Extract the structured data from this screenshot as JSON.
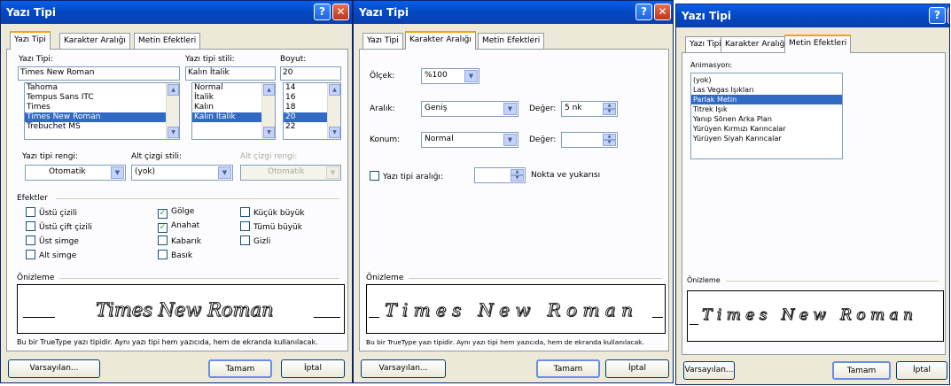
{
  "title": "Yazı Tipi",
  "help": "?",
  "close": "✕",
  "tabs": [
    "Yazı Tipi",
    "Karakter Aralığı",
    "Metin Efektleri"
  ],
  "font_tab": {
    "font_label": "Yazı Tipi:",
    "font_value": "Times New Roman",
    "fonts": [
      "Tahoma",
      "Tempus Sans ITC",
      "Times",
      "Times New Roman",
      "Trebuchet MS"
    ],
    "style_label": "Yazı tipi stili:",
    "style_value": "Kalın İtalik",
    "styles": [
      "Normal",
      "İtalik",
      "Kalın",
      "Kalın İtalik"
    ],
    "size_label": "Boyut:",
    "size_value": "20",
    "sizes": [
      "14",
      "16",
      "18",
      "20",
      "22"
    ],
    "color_label": "Yazı tipi rengi:",
    "color_value": "Otomatik",
    "underline_label": "Alt çizgi stili:",
    "underline_value": "(yok)",
    "underline_color_label": "Alt çizgi rengi:",
    "underline_color_value": "Otomatik",
    "effects_label": "Efektler",
    "effects": {
      "strike": "Üstü çizili",
      "dstrike": "Üstü çift çizili",
      "sup": "Üst simge",
      "sub": "Alt simge",
      "shadow": "Gölge",
      "outline": "Anahat",
      "emboss": "Kabarık",
      "engrave": "Basık",
      "smallcaps": "Küçük büyük",
      "allcaps": "Tümü büyük",
      "hidden": "Gizli"
    },
    "checked_mark": "✓"
  },
  "spacing_tab": {
    "scale_label": "Ölçek:",
    "scale_value": "%100",
    "spacing_label": "Aralık:",
    "spacing_value": "Geniş",
    "value_label": "Değer:",
    "spacing_amount": "5 nk",
    "position_label": "Konum:",
    "position_value": "Normal",
    "value2_label": "Değer:",
    "kerning_label": "Yazı tipi aralığı:",
    "kerning_suffix": "Nokta ve yukarısı"
  },
  "effects_tab": {
    "anim_label": "Animasyon:",
    "animations": [
      "(yok)",
      "Las Vegas Işıkları",
      "Parlak Metin",
      "Titrek Işık",
      "Yanıp Sönen Arka Plan",
      "Yürüyen Kırmızı Karıncalar",
      "Yürüyen Siyah Karıncalar"
    ]
  },
  "preview_label": "Önizleme",
  "preview_text": "Times New Roman",
  "preview_text_spaced": "T i m e s   N e w   R o m a n",
  "truetype_note": "Bu bir TrueType yazı tipidir. Aynı yazı tipi hem yazıcıda, hem de ekranda kullanılacak.",
  "buttons": {
    "default": "Varsayılan...",
    "ok": "Tamam",
    "cancel": "İptal"
  }
}
